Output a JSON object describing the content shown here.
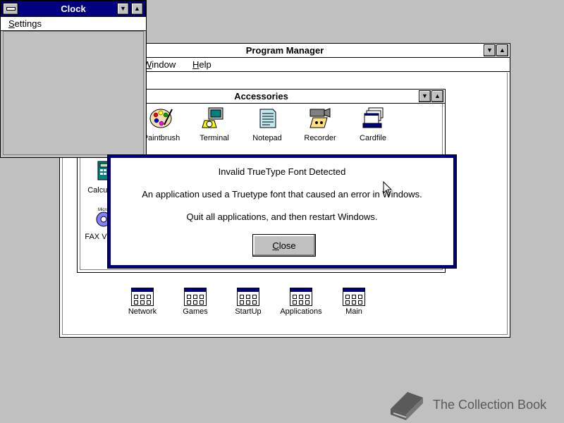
{
  "desktop": {
    "background": "#c0c0c0"
  },
  "program_manager": {
    "title": "Program Manager",
    "menu": {
      "window_label": "Window",
      "help_label": "Help"
    },
    "groups": [
      {
        "label": "Network"
      },
      {
        "label": "Games"
      },
      {
        "label": "StartUp"
      },
      {
        "label": "Applications"
      },
      {
        "label": "Main"
      }
    ]
  },
  "accessories": {
    "title": "Accessories",
    "icons": [
      {
        "label": "Paintbrush",
        "icon": "paintbrush-icon"
      },
      {
        "label": "Terminal",
        "icon": "terminal-icon"
      },
      {
        "label": "Notepad",
        "icon": "notepad-icon"
      },
      {
        "label": "Recorder",
        "icon": "recorder-icon"
      },
      {
        "label": "Cardfile",
        "icon": "cardfile-icon"
      },
      {
        "label": "Calculator",
        "icon": "calculator-icon"
      },
      {
        "label": "FAX Viewer",
        "icon": "fax-viewer-icon"
      }
    ]
  },
  "clock": {
    "title": "Clock",
    "menu": {
      "settings_label": "Settings"
    }
  },
  "dialog": {
    "title": "Invalid TrueType Font Detected",
    "message": "An application used a Truetype font that caused an error in Windows.",
    "instruction": "Quit all applications, and then restart Windows.",
    "close_label": "Close",
    "border_color": "#000080"
  },
  "watermark": {
    "text": "The Collection Book",
    "icon": "book-icon"
  },
  "colors": {
    "active_title": "#000080",
    "face": "#c0c0c0"
  }
}
